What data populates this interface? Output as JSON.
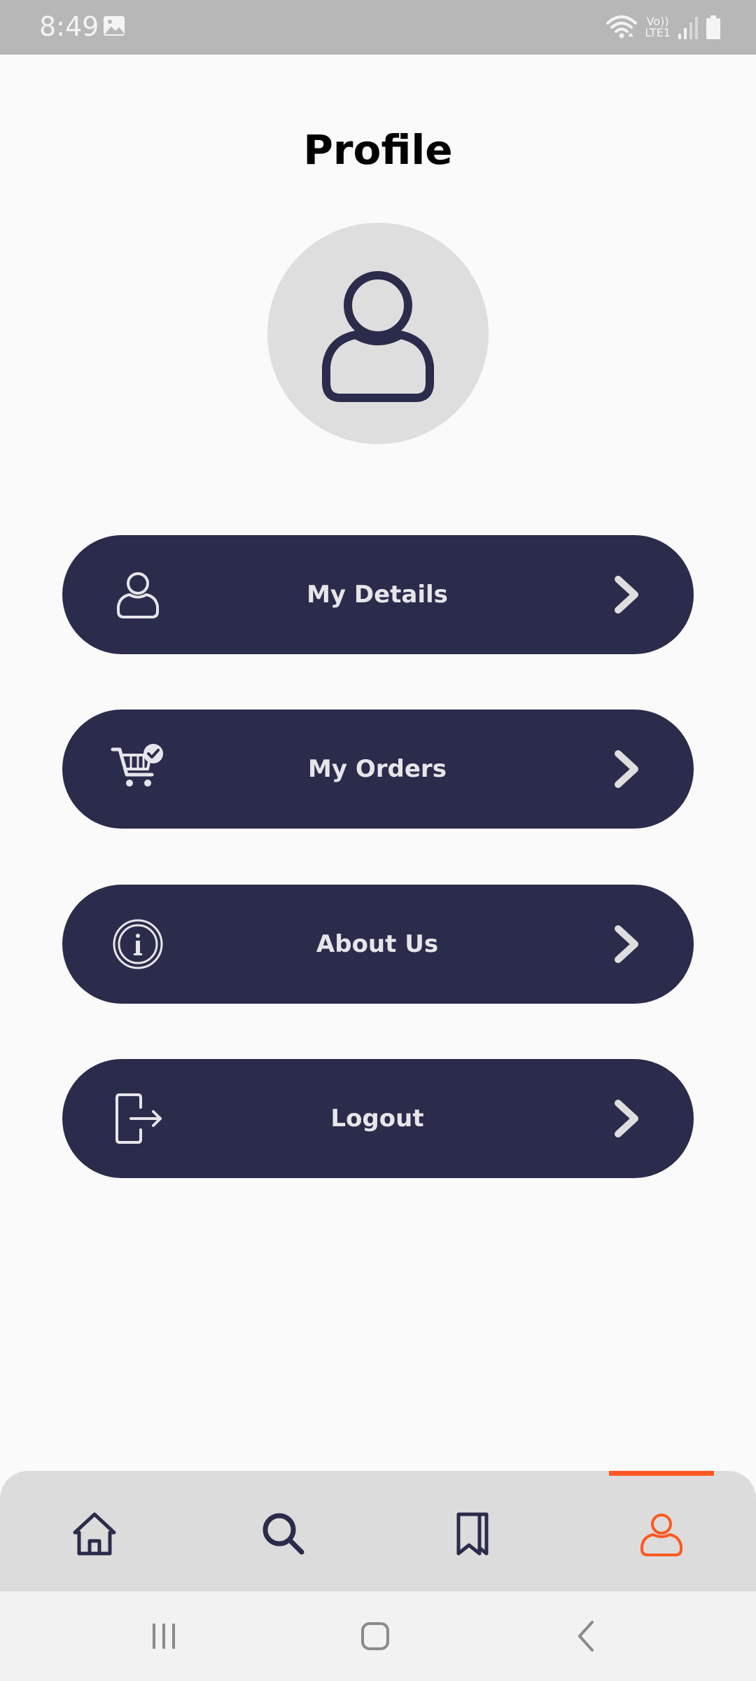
{
  "status_bar": {
    "time": "8:49",
    "icons": [
      "image-icon",
      "wifi-icon",
      "volte-icon",
      "signal-icon",
      "battery-icon"
    ],
    "volte_line1": "Vo))",
    "volte_line2": "LTE1"
  },
  "page": {
    "title": "Profile"
  },
  "avatar": {
    "icon": "user-icon",
    "background": "#dedede"
  },
  "menu": {
    "items": [
      {
        "label": "My Details",
        "icon": "user-icon"
      },
      {
        "label": "My Orders",
        "icon": "cart-check-icon"
      },
      {
        "label": "About Us",
        "icon": "info-icon"
      },
      {
        "label": "Logout",
        "icon": "logout-icon"
      }
    ],
    "button_color": "#2b2b4c",
    "text_color": "#e6e6ea"
  },
  "bottom_nav": {
    "items": [
      {
        "icon": "home-icon",
        "active": false
      },
      {
        "icon": "search-icon",
        "active": false
      },
      {
        "icon": "bookmark-icon",
        "active": false
      },
      {
        "icon": "profile-icon",
        "active": true
      }
    ],
    "active_color": "#ff5722",
    "inactive_color": "#2b2b4c"
  },
  "system_nav": {
    "icons": [
      "recents-icon",
      "home-button-icon",
      "back-icon"
    ]
  }
}
